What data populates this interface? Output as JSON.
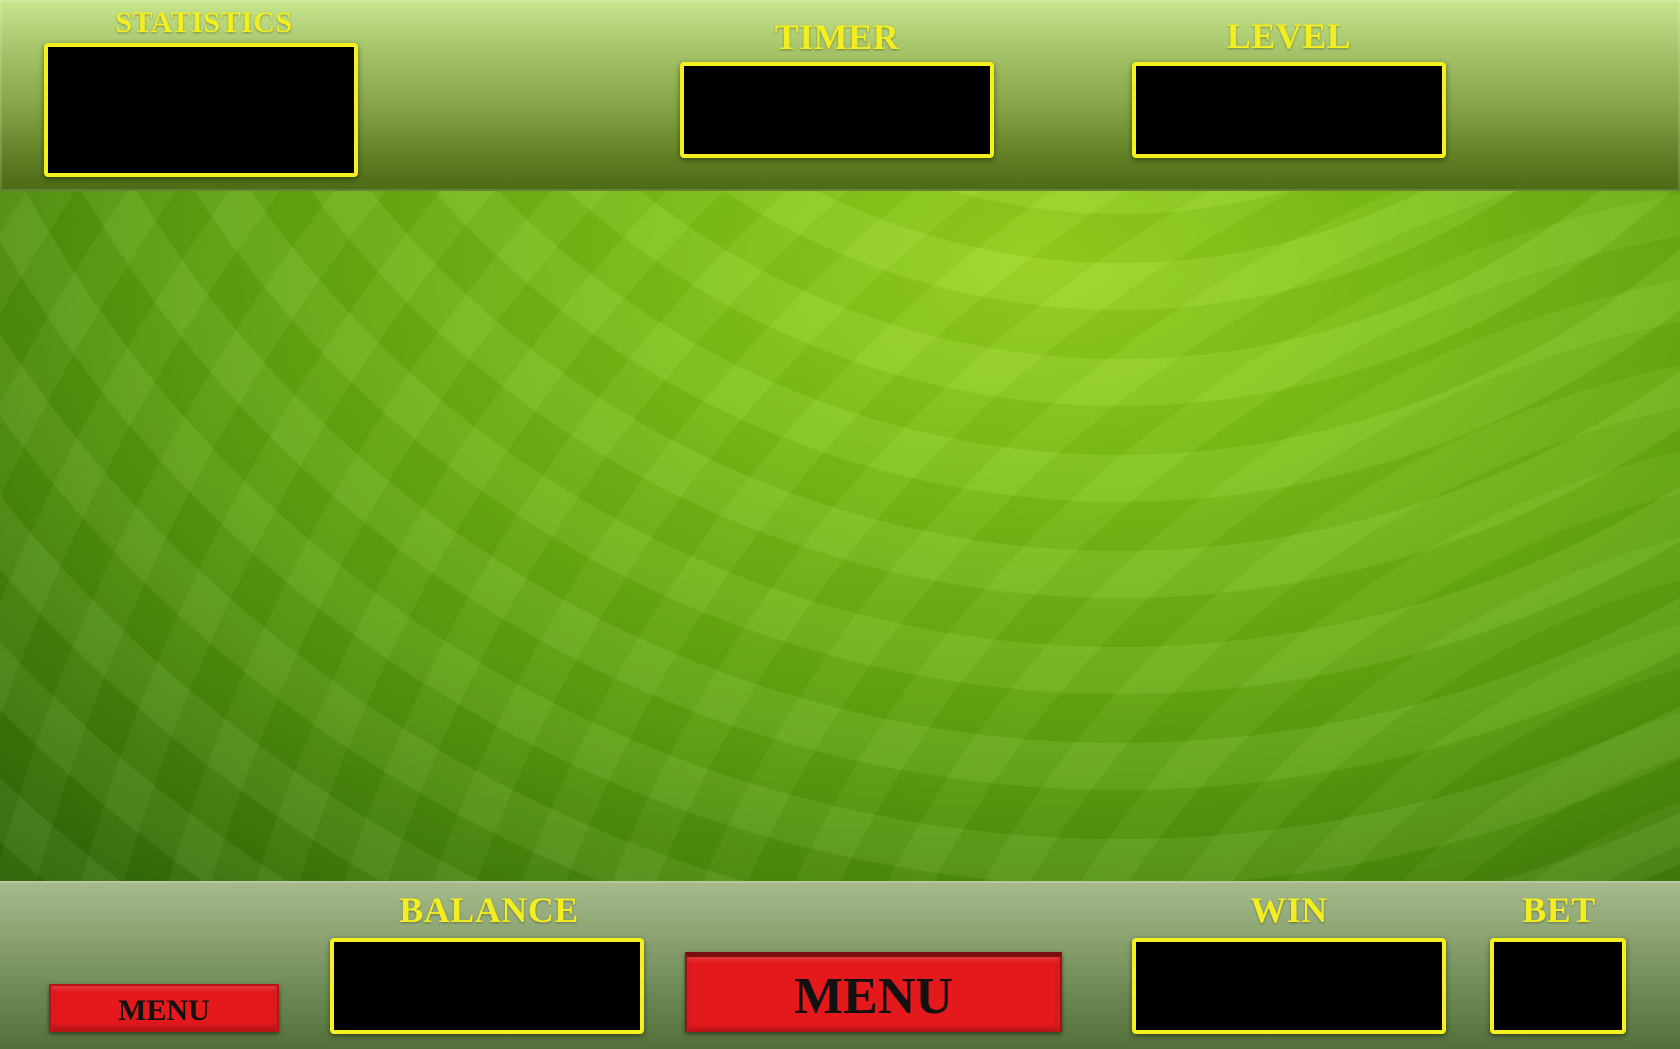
{
  "top": {
    "statistics_label": "STATISTICS",
    "timer_label": "TIMER",
    "level_label": "LEVEL"
  },
  "bottom": {
    "balance_label": "BALANCE",
    "win_label": "WIN",
    "bet_label": "BET",
    "menu_small_label": "MENU",
    "menu_large_label": "MENU"
  },
  "colors": {
    "label_yellow": "#f2ee1f",
    "panel_border": "#f5f01e",
    "button_red": "#e3191c",
    "field_green": "#7bbf16"
  }
}
